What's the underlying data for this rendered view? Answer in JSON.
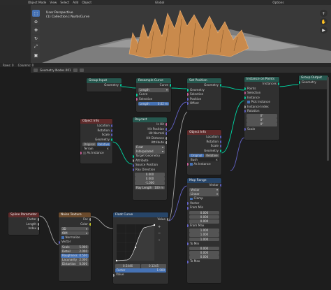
{
  "topbar": {
    "items": [
      "Object Mode",
      "View",
      "Select",
      "Add",
      "Object"
    ],
    "global": "Global",
    "options": "Options"
  },
  "viewport": {
    "line1": "User Perspective",
    "line2": "(1) Collection | NurbsCurve"
  },
  "strip": {
    "items": [
      "Rows: 0",
      "Columns: 0"
    ]
  },
  "editor": {
    "name": "Geometry Nodes.001"
  },
  "nodes": {
    "group_input": {
      "title": "Group Input",
      "out": "Geometry"
    },
    "group_output": {
      "title": "Group Output",
      "in": "Geometry"
    },
    "resample": {
      "title": "Resample Curve",
      "out": "Curve",
      "mode": "Length",
      "in_curve": "Curve",
      "in_selection": "Selection",
      "length_label": "Length",
      "length_value": "0.02 m"
    },
    "set_position": {
      "title": "Set Position",
      "out": "Geometry",
      "in_geometry": "Geometry",
      "in_selection": "Selection",
      "in_position": "Position",
      "in_offset": "Offset"
    },
    "instance": {
      "title": "Instance on Points",
      "out": "Instances",
      "in_points": "Points",
      "in_selection": "Selection",
      "in_instance": "Instance",
      "in_pick": "Pick Instance",
      "in_index": "Instance Index",
      "in_rotation": "Rotation",
      "rot": [
        "0°",
        "0°",
        "0°"
      ],
      "in_scale": "Scale"
    },
    "object_info_1": {
      "title": "Object Info",
      "outs": [
        "Location",
        "Rotation",
        "Scale",
        "Geometry"
      ],
      "modes": [
        "Original",
        "Relative"
      ],
      "object": "Terrain",
      "as_instance": "As Instance"
    },
    "raycast": {
      "title": "Raycast",
      "outs": [
        "Is Hit",
        "Hit Position",
        "Hit Normal",
        "Hit Distance",
        "Attribute"
      ],
      "type": "Float",
      "interp": "Interpolated",
      "ins": [
        "Target Geometry",
        "Attribute",
        "Source Position",
        "Ray Direction"
      ],
      "dir": [
        "0.000",
        "0.000",
        "-1.000"
      ],
      "ray_length_label": "Ray Length",
      "ray_length_value": "100 m"
    },
    "object_info_2": {
      "title": "Object Info",
      "outs": [
        "Location",
        "Rotation",
        "Scale",
        "Geometry"
      ],
      "modes": [
        "Original",
        "Relative"
      ],
      "object": "Bush",
      "as_instance": "As Instance"
    },
    "map_range": {
      "title": "Map Range",
      "out": "Vector",
      "dtype": "Vector",
      "interp": "Linear",
      "clamp": "Clamp",
      "in_vector": "Vector",
      "from_min": "From Min",
      "from_min_v": [
        "0.000",
        "0.000",
        "0.000"
      ],
      "from_max": "From Max",
      "from_max_v": [
        "1.000",
        "1.000",
        "1.000"
      ],
      "to_min": "To Min",
      "to_min_v": [
        "0.000",
        "0.000",
        "0.000"
      ],
      "to_max": "To Max"
    },
    "spline_param": {
      "title": "Spline Parameter",
      "outs": [
        "Factor",
        "Length",
        "Index"
      ]
    },
    "noise": {
      "title": "Noise Texture",
      "outs": [
        "Fac",
        "Color"
      ],
      "dim": "3D",
      "basis": "fBM",
      "normalize": "Normalize",
      "in_vector": "Vector",
      "params": [
        {
          "k": "Scale",
          "v": "5.000"
        },
        {
          "k": "Detail",
          "v": "2.000"
        },
        {
          "k": "Roughness",
          "v": "0.500"
        },
        {
          "k": "Lacunarity",
          "v": "2.000"
        },
        {
          "k": "Distortion",
          "v": "0.000"
        }
      ]
    },
    "float_curve": {
      "title": "Float Curve",
      "out": "Value",
      "x_val": "0.5446",
      "y_val": "0.1245",
      "factor_label": "Factor",
      "factor_value": "1.000",
      "in_value": "Value"
    }
  }
}
